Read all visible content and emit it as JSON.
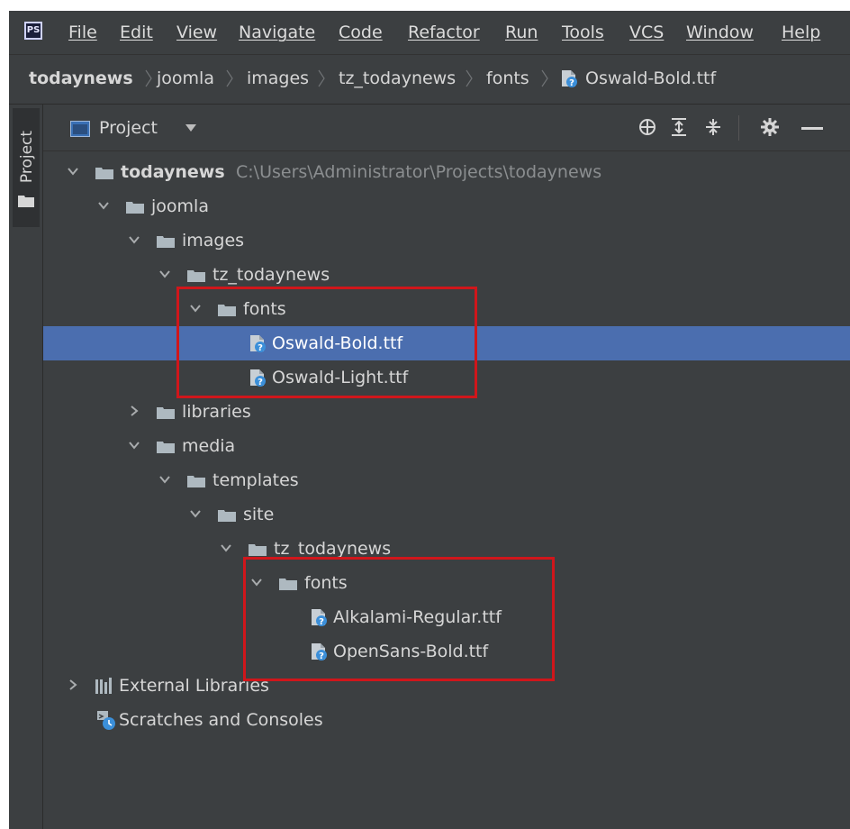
{
  "menubar": {
    "logo": "PS",
    "items": [
      "File",
      "Edit",
      "View",
      "Navigate",
      "Code",
      "Refactor",
      "Run",
      "Tools",
      "VCS",
      "Window",
      "Help"
    ]
  },
  "breadcrumb": [
    "todaynews",
    "joomla",
    "images",
    "tz_todaynews",
    "fonts",
    "Oswald-Bold.ttf"
  ],
  "tool_window": {
    "stripe_label": "Project",
    "view_selector": "Project"
  },
  "tree": {
    "root": {
      "label": "todaynews",
      "path": "C:\\Users\\Administrator\\Projects\\todaynews"
    },
    "joomla": "joomla",
    "images": "images",
    "tz_todaynews_1": "tz_todaynews",
    "fonts_1": "fonts",
    "oswald_bold": "Oswald-Bold.ttf",
    "oswald_light": "Oswald-Light.ttf",
    "libraries": "libraries",
    "media": "media",
    "templates": "templates",
    "site": "site",
    "tz_todaynews_2": "tz_todaynews",
    "fonts_2": "fonts",
    "alkalami": "Alkalami-Regular.ttf",
    "opensans": "OpenSans-Bold.ttf",
    "external_libraries": "External Libraries",
    "scratches": "Scratches and Consoles"
  },
  "colors": {
    "background": "#3c3f41",
    "selection": "#4b6eaf",
    "text": "#d6d6d6",
    "path_text": "#8b8e90",
    "folder": "#aeb9c0",
    "highlight_box": "#d0161b"
  }
}
